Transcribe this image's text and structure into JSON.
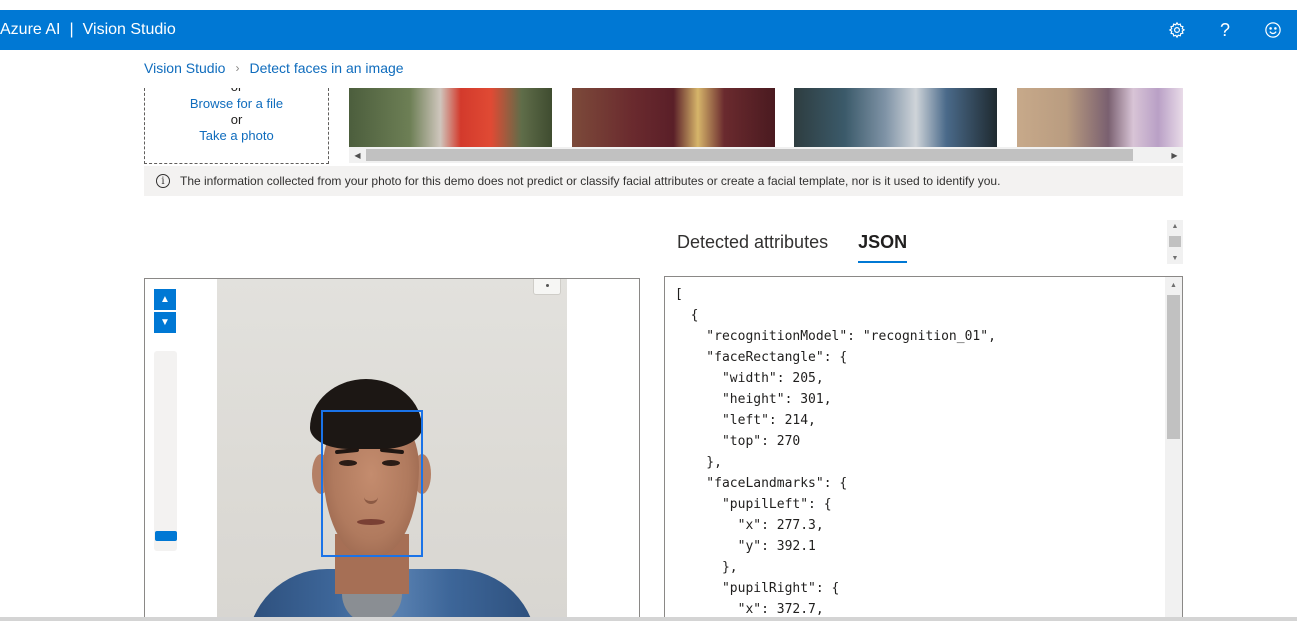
{
  "header": {
    "brand_left": "Azure AI",
    "separator": "|",
    "brand_right": "Vision Studio",
    "icons": [
      "gear-icon",
      "help-icon",
      "feedback-smile-icon"
    ],
    "help_glyph": "?"
  },
  "breadcrumb": {
    "items": [
      "Vision Studio",
      "Detect faces in an image"
    ]
  },
  "upload": {
    "or_top": "or",
    "browse_label": "Browse for a file",
    "or_mid": "or",
    "take_photo_label": "Take a photo"
  },
  "info_banner": {
    "text": "The information collected from your photo for this demo does not predict or classify facial attributes or create a facial template, nor is it used to identify you."
  },
  "tabs": [
    {
      "label": "Detected attributes",
      "active": false
    },
    {
      "label": "JSON",
      "active": true
    }
  ],
  "json_output": "[\n  {\n    \"recognitionModel\": \"recognition_01\",\n    \"faceRectangle\": {\n      \"width\": 205,\n      \"height\": 301,\n      \"left\": 214,\n      \"top\": 270\n    },\n    \"faceLandmarks\": {\n      \"pupilLeft\": {\n        \"x\": 277.3,\n        \"y\": 392.1\n      },\n      \"pupilRight\": {\n        \"x\": 372.7,",
  "colors": {
    "header_bg": "#0078d4",
    "accent": "#0078d4",
    "link": "#0f6cbd",
    "face_box": "#1a73e8",
    "info_bg": "#f3f2f1"
  }
}
